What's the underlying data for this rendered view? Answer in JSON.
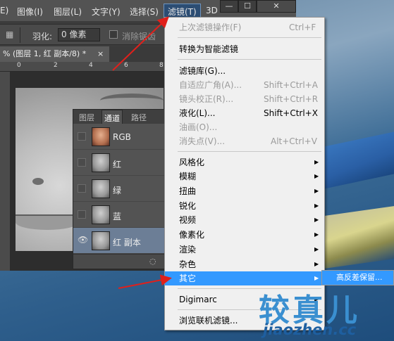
{
  "menubar": {
    "items": [
      {
        "label": "E)"
      },
      {
        "label": "图像(I)"
      },
      {
        "label": "图层(L)"
      },
      {
        "label": "文字(Y)"
      },
      {
        "label": "选择(S)"
      },
      {
        "label": "滤镜(T)"
      },
      {
        "label": "3D"
      }
    ]
  },
  "window_buttons": {
    "minimize": "—",
    "maximize": "☐",
    "close": "✕"
  },
  "options_bar": {
    "feather_label": "羽化:",
    "feather_value": "0 像素",
    "antialias_label": "消除锯齿"
  },
  "document_tab": {
    "title": "% (图层 1, 红 副本/8) *",
    "close": "×"
  },
  "ruler": {
    "marks": [
      "0",
      "2",
      "4",
      "6",
      "8"
    ]
  },
  "channels_panel": {
    "tabs": [
      "图层",
      "通道",
      "路径"
    ],
    "channels": [
      {
        "name": "RGB",
        "visible": false
      },
      {
        "name": "红",
        "visible": false
      },
      {
        "name": "绿",
        "visible": false
      },
      {
        "name": "蓝",
        "visible": false
      },
      {
        "name": "红 副本",
        "visible": true
      }
    ]
  },
  "filter_menu": {
    "items": [
      {
        "label": "上次滤镜操作(F)",
        "shortcut": "Ctrl+F",
        "disabled": true
      },
      {
        "label": "转换为智能滤镜",
        "shortcut": "",
        "disabled": false
      },
      {
        "label": "滤镜库(G)...",
        "shortcut": "",
        "disabled": false
      },
      {
        "label": "自适应广角(A)...",
        "shortcut": "Shift+Ctrl+A",
        "disabled": true
      },
      {
        "label": "镜头校正(R)...",
        "shortcut": "Shift+Ctrl+R",
        "disabled": true
      },
      {
        "label": "液化(L)...",
        "shortcut": "Shift+Ctrl+X",
        "disabled": false
      },
      {
        "label": "油画(O)...",
        "shortcut": "",
        "disabled": true
      },
      {
        "label": "消失点(V)...",
        "shortcut": "Alt+Ctrl+V",
        "disabled": true
      },
      {
        "label": "风格化",
        "submenu": true
      },
      {
        "label": "模糊",
        "submenu": true
      },
      {
        "label": "扭曲",
        "submenu": true
      },
      {
        "label": "锐化",
        "submenu": true
      },
      {
        "label": "视频",
        "submenu": true
      },
      {
        "label": "像素化",
        "submenu": true
      },
      {
        "label": "渲染",
        "submenu": true
      },
      {
        "label": "杂色",
        "submenu": true
      },
      {
        "label": "其它",
        "submenu": true,
        "highlighted": true
      },
      {
        "label": "Digimarc",
        "submenu": true
      },
      {
        "label": "浏览联机滤镜...",
        "shortcut": "",
        "disabled": false
      }
    ],
    "arrow_glyph": "▶"
  },
  "submenu": {
    "item": "高反差保留..."
  },
  "watermark": {
    "big": "较真儿",
    "small": "jiaozhen.cc"
  },
  "colors": {
    "highlight": "#3399ff",
    "arrow": "#e0201b"
  }
}
